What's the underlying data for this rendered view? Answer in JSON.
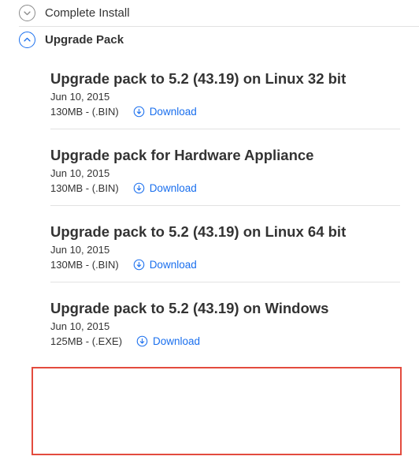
{
  "sections": {
    "collapsed": {
      "title": "Complete Install"
    },
    "expanded": {
      "title": "Upgrade Pack"
    }
  },
  "items": [
    {
      "title": "Upgrade pack to 5.2 (43.19) on Linux 32 bit",
      "date": "Jun 10, 2015",
      "meta": "130MB - (.BIN)",
      "download": "Download"
    },
    {
      "title": "Upgrade pack for Hardware Appliance",
      "date": "Jun 10, 2015",
      "meta": "130MB - (.BIN)",
      "download": "Download"
    },
    {
      "title": "Upgrade pack to 5.2 (43.19) on Linux 64 bit",
      "date": "Jun 10, 2015",
      "meta": "130MB - (.BIN)",
      "download": "Download"
    },
    {
      "title": "Upgrade pack to 5.2 (43.19) on Windows",
      "date": "Jun 10, 2015",
      "meta": "125MB - (.EXE)",
      "download": "Download"
    }
  ]
}
